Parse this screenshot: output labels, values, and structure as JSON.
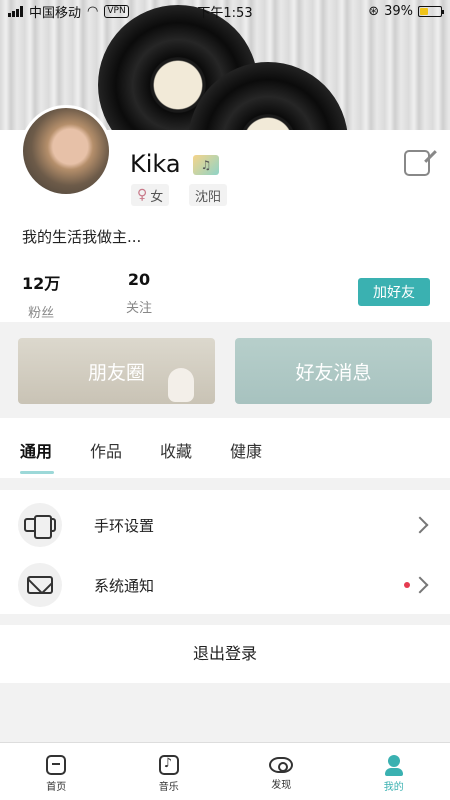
{
  "status_bar": {
    "carrier": "中国移动",
    "vpn": "VPN",
    "time": "下午1:53",
    "battery": "39%",
    "battery_level": 0.39
  },
  "profile": {
    "name": "Kika",
    "gender": "女",
    "city": "沈阳",
    "bio": "我的生活我做主...",
    "fans_count": "12万",
    "fans_label": "粉丝",
    "follow_count": "20",
    "follow_label": "关注",
    "add_friend_label": "加好友"
  },
  "cards": [
    {
      "label": "朋友圈"
    },
    {
      "label": "好友消息"
    }
  ],
  "tabs": [
    {
      "label": "通用",
      "active": true
    },
    {
      "label": "作品",
      "active": false
    },
    {
      "label": "收藏",
      "active": false
    },
    {
      "label": "健康",
      "active": false
    }
  ],
  "settings": [
    {
      "label": "手环设置",
      "icon": "wristband-icon"
    },
    {
      "label": "系统通知",
      "icon": "envelope-icon",
      "has_dot": true
    }
  ],
  "logout_label": "退出登录",
  "tabbar": [
    {
      "label": "首页",
      "icon": "home-icon",
      "active": false
    },
    {
      "label": "音乐",
      "icon": "music-icon",
      "active": false
    },
    {
      "label": "发现",
      "icon": "eye-icon",
      "active": false
    },
    {
      "label": "我的",
      "icon": "person-icon",
      "active": true
    }
  ],
  "colors": {
    "accent": "#3ab1b1",
    "notification_dot": "#e53b50"
  }
}
